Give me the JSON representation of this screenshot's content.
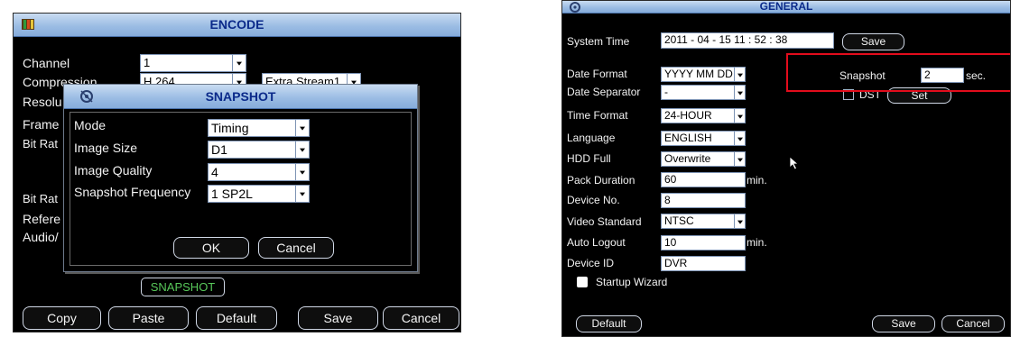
{
  "encode": {
    "title": "ENCODE",
    "channel": {
      "label": "Channel",
      "value": "1"
    },
    "compression": {
      "label": "Compression",
      "value": "H.264",
      "stream": "Extra Stream1"
    },
    "resolution_label": "Resolu",
    "frame_label": "Frame",
    "bitrate_label1": "Bit Rat",
    "bitrate_label2": "Bit Rat",
    "reference_label": "Refere",
    "audio_label": "Audio/",
    "snapshot_tag": "SNAPSHOT",
    "buttons": {
      "copy": "Copy",
      "paste": "Paste",
      "default": "Default",
      "save": "Save",
      "cancel": "Cancel"
    }
  },
  "snapshot_dialog": {
    "title": "SNAPSHOT",
    "mode": {
      "label": "Mode",
      "value": "Timing"
    },
    "image_size": {
      "label": "Image Size",
      "value": "D1"
    },
    "image_quality": {
      "label": "Image Quality",
      "value": "4"
    },
    "snapshot_frequency": {
      "label": "Snapshot Frequency",
      "value": "1 SP2L"
    },
    "ok": "OK",
    "cancel": "Cancel"
  },
  "general": {
    "title": "GENERAL",
    "system_time": {
      "label": "System Time",
      "value": "2011 - 04 - 15  11 : 52 : 38",
      "save": "Save"
    },
    "date_format": {
      "label": "Date Format",
      "value": "YYYY MM DD"
    },
    "date_separator": {
      "label": "Date Separator",
      "value": "-"
    },
    "time_format": {
      "label": "Time Format",
      "value": "24-HOUR"
    },
    "language": {
      "label": "Language",
      "value": "ENGLISH"
    },
    "hdd_full": {
      "label": "HDD Full",
      "value": "Overwrite"
    },
    "pack_duration": {
      "label": "Pack Duration",
      "value": "60",
      "unit": "min."
    },
    "device_no": {
      "label": "Device No.",
      "value": "8"
    },
    "video_standard": {
      "label": "Video Standard",
      "value": "NTSC"
    },
    "auto_logout": {
      "label": "Auto Logout",
      "value": "10",
      "unit": "min."
    },
    "device_id": {
      "label": "Device ID",
      "value": "DVR"
    },
    "startup_wizard": {
      "label": "Startup Wizard",
      "checked": true
    },
    "snapshot": {
      "label": "Snapshot",
      "value": "2",
      "unit": "sec."
    },
    "dst": {
      "label": "DST",
      "checked": false,
      "set": "Set"
    },
    "buttons": {
      "default": "Default",
      "save": "Save",
      "cancel": "Cancel"
    }
  },
  "colors": {
    "title_text": "#0b2a8a",
    "snapshot_tag_text": "#58c85a",
    "highlight": "#e20c1c"
  }
}
